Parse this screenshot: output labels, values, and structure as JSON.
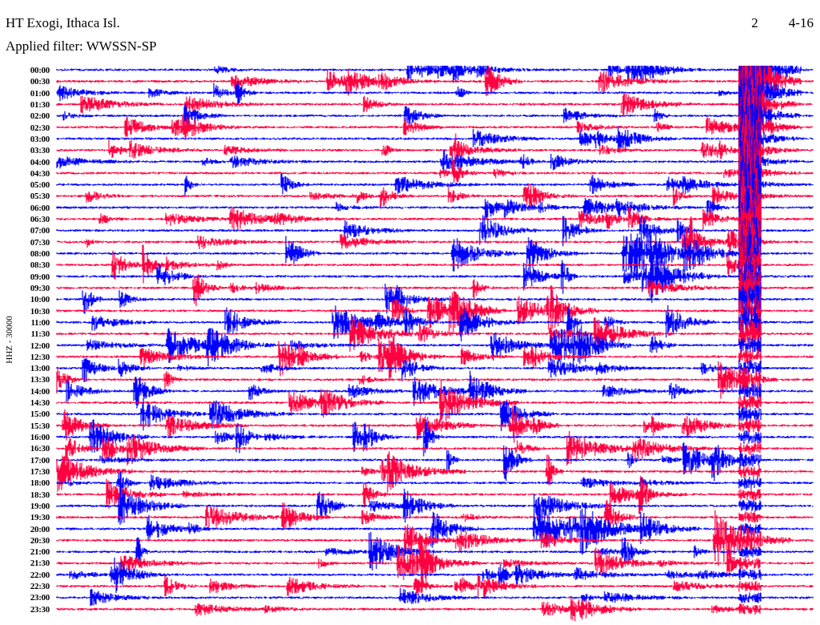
{
  "header": {
    "station": "HT Exogi, Ithaca Isl.",
    "date_fragments": [
      "2",
      "4-16"
    ],
    "filter": "Applied filter: WWSSN-SP"
  },
  "axis_label": "HHZ - 30000",
  "rows": [
    {
      "time": "00:00"
    },
    {
      "time": "00:30"
    },
    {
      "time": "01:00"
    },
    {
      "time": "01:30"
    },
    {
      "time": "02:00"
    },
    {
      "time": "02:30"
    },
    {
      "time": "03:00"
    },
    {
      "time": "03:30"
    },
    {
      "time": "04:00"
    },
    {
      "time": "04:30"
    },
    {
      "time": "05:00"
    },
    {
      "time": "05:30"
    },
    {
      "time": "06:00"
    },
    {
      "time": "06:30"
    },
    {
      "time": "07:00"
    },
    {
      "time": "07:30"
    },
    {
      "time": "08:00"
    },
    {
      "time": "08:30"
    },
    {
      "time": "09:00"
    },
    {
      "time": "09:30"
    },
    {
      "time": "10:00"
    },
    {
      "time": "10:30"
    },
    {
      "time": "11:00"
    },
    {
      "time": "11:30"
    },
    {
      "time": "12:00"
    },
    {
      "time": "12:30"
    },
    {
      "time": "13:00"
    },
    {
      "time": "13:30"
    },
    {
      "time": "14:00"
    },
    {
      "time": "14:30"
    },
    {
      "time": "15:00"
    },
    {
      "time": "15:30"
    },
    {
      "time": "16:00"
    },
    {
      "time": "16:30"
    },
    {
      "time": "17:00"
    },
    {
      "time": "17:30"
    },
    {
      "time": "18:00"
    },
    {
      "time": "18:30"
    },
    {
      "time": "19:00"
    },
    {
      "time": "19:30"
    },
    {
      "time": "20:00"
    },
    {
      "time": "20:30"
    },
    {
      "time": "21:00"
    },
    {
      "time": "21:30"
    },
    {
      "time": "22:00"
    },
    {
      "time": "22:30"
    },
    {
      "time": "23:00"
    },
    {
      "time": "23:30"
    }
  ]
}
